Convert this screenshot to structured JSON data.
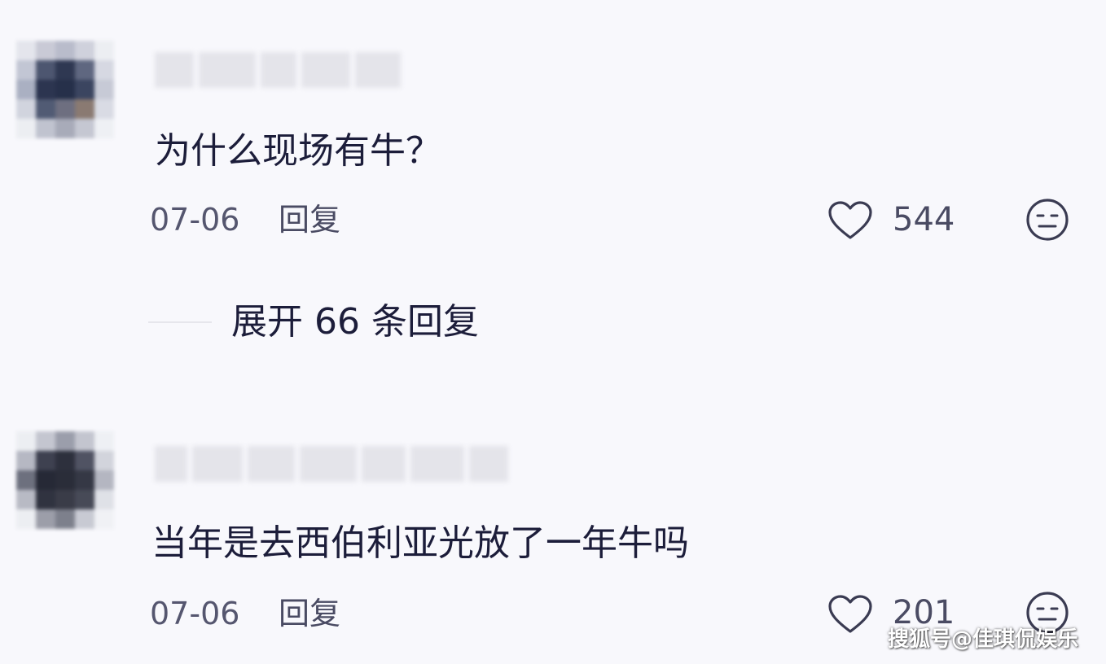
{
  "comments": [
    {
      "text": "为什么现场有牛？",
      "date": "07-06",
      "reply_label": "回复",
      "like_count": "544",
      "expand_label": "展开 66 条回复"
    },
    {
      "text": "当年是去西伯利亚光放了一年牛吗",
      "date": "07-06",
      "reply_label": "回复",
      "like_count": "201"
    }
  ],
  "watermark": "搜狐号@佳琪侃娱乐",
  "icons": {
    "like": "heart-outline-icon",
    "dislike": "expressionless-face-icon"
  },
  "colors": {
    "background": "#f8f8fc",
    "text_primary": "#1c1d3a",
    "text_secondary": "#55566f",
    "icon": "#3a3b52"
  }
}
